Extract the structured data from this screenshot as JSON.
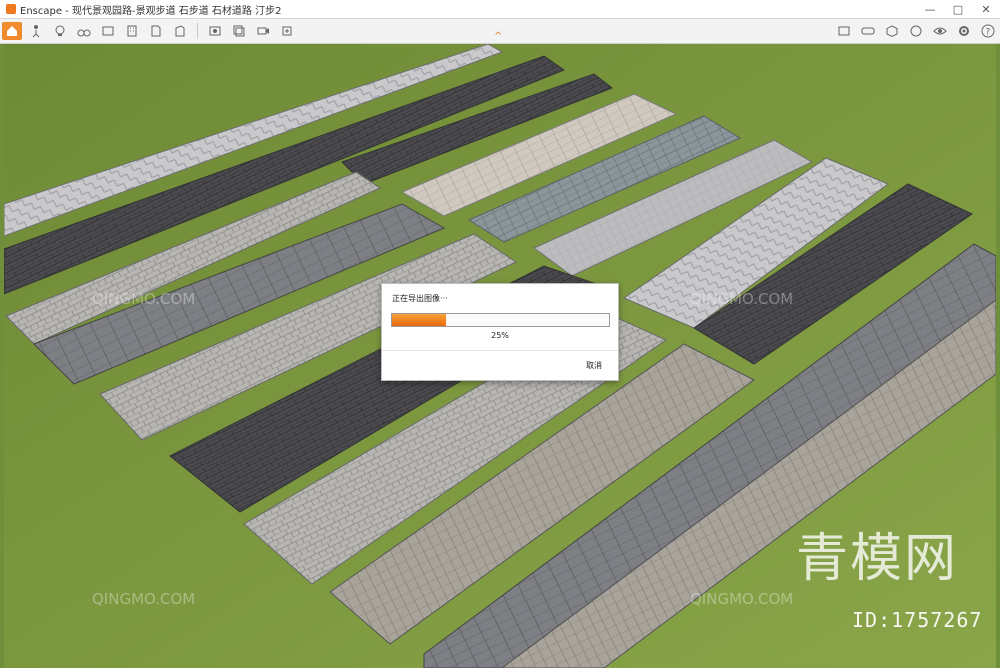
{
  "window": {
    "title": "Enscape - 现代景观园路-景观步道 石步道 石材道路 汀步2",
    "controls": [
      "—",
      "□",
      "✕"
    ]
  },
  "toolbar": {
    "collapse_arrow": "^",
    "accent": "#f08a2c"
  },
  "dialog": {
    "title": "正在导出图像···",
    "progress": 0.25,
    "progress_label": "25%",
    "cancel_label": "取消"
  },
  "watermark": {
    "text": "QINGMO.COM",
    "brand": "青模网",
    "id": "ID:1757267"
  }
}
